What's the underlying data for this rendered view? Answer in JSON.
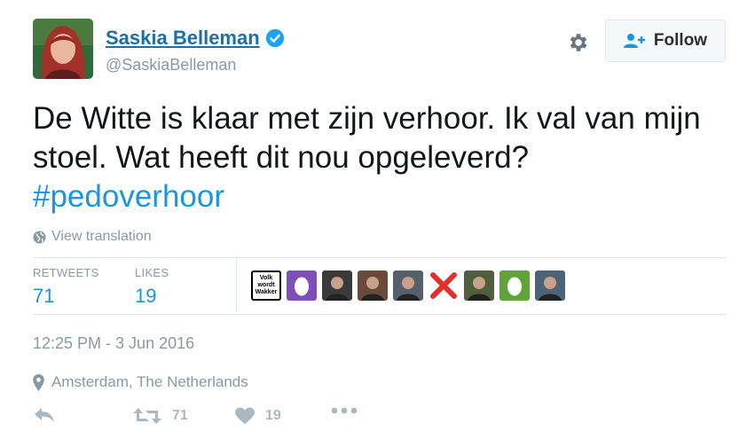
{
  "author": {
    "name": "Saskia Belleman",
    "handle": "@SaskiaBelleman",
    "verified": true
  },
  "header": {
    "follow_label": "Follow",
    "settings_icon": "gear-icon",
    "follow_icon": "add-user-icon"
  },
  "tweet": {
    "text": "De Witte is klaar met zijn verhoor. Ik val van mijn stoel. Wat heeft dit nou opgeleverd?",
    "hashtag": "#pedoverhoor",
    "translate_label": "View translation"
  },
  "stats": {
    "retweets_label": "RETWEETS",
    "retweets_value": "71",
    "likes_label": "LIKES",
    "likes_value": "19"
  },
  "likers": [
    {
      "kind": "text",
      "label": "Volk wordt Wakker"
    },
    {
      "kind": "egg",
      "color": "#7e4fb8"
    },
    {
      "kind": "photo",
      "color": "#3a3a3a"
    },
    {
      "kind": "photo",
      "color": "#6b4a3a"
    },
    {
      "kind": "photo",
      "color": "#55606b"
    },
    {
      "kind": "cross",
      "color": "#e0312b"
    },
    {
      "kind": "photo",
      "color": "#4f5e3c"
    },
    {
      "kind": "egg",
      "color": "#5fa33a"
    },
    {
      "kind": "photo",
      "color": "#4b6478"
    }
  ],
  "meta": {
    "timestamp": "12:25 PM - 3 Jun 2016",
    "location": "Amsterdam, The Netherlands"
  },
  "actions": {
    "reply_icon": "reply-icon",
    "retweet_icon": "retweet-icon",
    "retweet_count": "71",
    "like_icon": "heart-icon",
    "like_count": "19",
    "more_icon": "more-dots-icon"
  },
  "colors": {
    "link": "#1b95e0",
    "name": "#1b6fa8",
    "muted": "#8899a6",
    "verified": "#1da1f2"
  }
}
